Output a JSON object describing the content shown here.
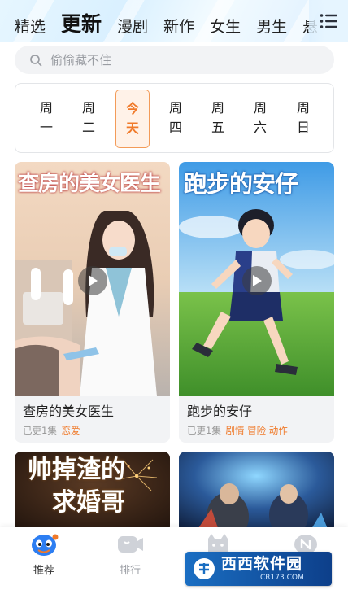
{
  "tabs": [
    "精选",
    "更新",
    "漫剧",
    "新作",
    "女生",
    "男生",
    "悬"
  ],
  "active_tab": "更新",
  "search": {
    "placeholder": "偷偷藏不住"
  },
  "week_days": [
    {
      "top": "周",
      "bottom": "一"
    },
    {
      "top": "周",
      "bottom": "二"
    },
    {
      "top": "今",
      "bottom": "天",
      "selected": true
    },
    {
      "top": "周",
      "bottom": "四"
    },
    {
      "top": "周",
      "bottom": "五"
    },
    {
      "top": "周",
      "bottom": "六"
    },
    {
      "top": "周",
      "bottom": "日"
    }
  ],
  "cards": [
    {
      "cover_title": "查房的美女医生",
      "title": "查房的美女医生",
      "updated": "已更1集",
      "tags": "恋爱"
    },
    {
      "cover_title": "跑步的安仔",
      "title": "跑步的安仔",
      "updated": "已更1集",
      "tags": "剧情 冒险 动作"
    },
    {
      "cover_title_line1": "帅掉渣的",
      "cover_title_line2": "求婚哥"
    },
    {
      "cover_title": ""
    }
  ],
  "bottom_nav": [
    {
      "label": "推荐",
      "icon": "mascot-icon"
    },
    {
      "label": "排行",
      "icon": "video-rank-icon"
    },
    {
      "label": "",
      "icon": "cat-icon"
    },
    {
      "label": "",
      "icon": "n-badge-icon"
    }
  ],
  "watermark": {
    "brand": "西西软件园",
    "url": "CR173.COM"
  },
  "colors": {
    "accent": "#f07a2a",
    "tab_bg": "#dff2ff",
    "card_bg": "#f2f3f5"
  }
}
